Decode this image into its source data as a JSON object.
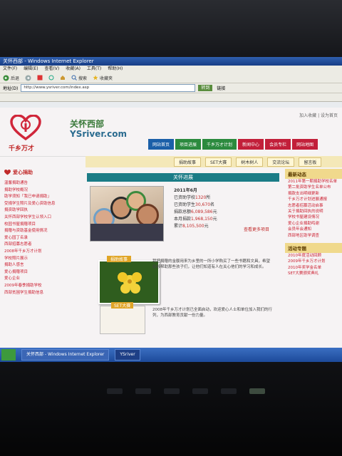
{
  "window": {
    "title": "关怀西部 - Windows Internet Explorer"
  },
  "menu": [
    "文件(F)",
    "编辑(E)",
    "查看(V)",
    "收藏(A)",
    "工具(T)",
    "帮助(H)"
  ],
  "toolbar": {
    "back": "后退",
    "forward": "",
    "stop": "",
    "refresh": "",
    "home": "",
    "search": "搜索",
    "favorites": "收藏夹",
    "history": ""
  },
  "address": {
    "label": "地址(D)",
    "url": "http://www.ysriver.com/index.asp",
    "go": "转到",
    "links": "链接"
  },
  "site": {
    "logo_text": "千乡万才",
    "name_cn": "关怀西部",
    "name_en": "YSriver.com",
    "top_links": "加入收藏 | 设为首页",
    "nav": [
      {
        "label": "网站首页",
        "color": "#1b5fa8"
      },
      {
        "label": "项目进展",
        "color": "#2b8a3e"
      },
      {
        "label": "千乡万才计划",
        "color": "#2b8a3e"
      },
      {
        "label": "新闻中心",
        "color": "#c21f3a"
      },
      {
        "label": "会员专栏",
        "color": "#c21f3a"
      },
      {
        "label": "网站地图",
        "color": "#c21f3a"
      }
    ],
    "subnav": [
      "捐助故事",
      "SET大赛",
      "树木树人",
      "交流论坛",
      "留言板"
    ]
  },
  "left": {
    "title": "爱心捐助",
    "items": [
      "温馨捐助通告",
      "捐助学校概况",
      "助学须知「我已申请捐助」",
      "受捐学生照片及爱心资助信息",
      "捐资助学回执",
      "关怀西部学校学生认领入口",
      "校园书屋捐赠项目",
      "捐赠与资助基金使用情况",
      "爱心园丁名录",
      "西部招募志愿者",
      "2008年千乡万才计划",
      "学校照片展示",
      "捐助人感言",
      "爱心捐赠项目",
      "爱心企业",
      "2009年春季捐助学校",
      "西部贫困学生捐助信息"
    ]
  },
  "center": {
    "section_title": "关怀进展",
    "date": "2011年6月",
    "stats": [
      {
        "prefix": "已资助学校",
        "value": "1320",
        "suffix": "所"
      },
      {
        "prefix": "已资助学生",
        "value": "30,670",
        "suffix": "名"
      },
      {
        "prefix": "捐款总额",
        "value": "6,089,586",
        "suffix": "元"
      },
      {
        "prefix": "本月捐款",
        "value": "1,968,150",
        "suffix": "元"
      },
      {
        "prefix": "累计",
        "value": "8,105,500",
        "suffix": "元"
      }
    ],
    "more": "查看更多项目",
    "flower_tag": "捐助故事",
    "para1": "我把捐赠的金额用来为乡里的一所小学购买了一些书籍和文具，希望能够帮助那些孩子们，让他们知道有人在关心他们的学习和成长。",
    "card2_tag": "SET大赛",
    "para2": "2008年千乡万才计划已全面启动，欢迎爱心人士和单位加入我们的行列，为西部教育贡献一份力量。"
  },
  "right": {
    "head1": "最新动态",
    "items1": [
      "2011年第一期捐助学校名单",
      "第二批资助学生名单公布",
      "捐款支出明细更新",
      "千乡万才计划进展通报",
      "志愿者招募活动启事",
      "关于捐助回执的说明",
      "学校书屋建设情况",
      "爱心企业捐助鸣谢",
      "会员年会通知",
      "西部地区助学调查"
    ],
    "head2": "活动专题",
    "items2": [
      "2010年度活动回顾",
      "2009年千乡万才计划",
      "2010年奖学金名单",
      "SET大赛颁奖典礼"
    ]
  },
  "taskbar": {
    "items": [
      "关怀西部 - Windows Internet Explorer",
      "YSriver"
    ]
  }
}
